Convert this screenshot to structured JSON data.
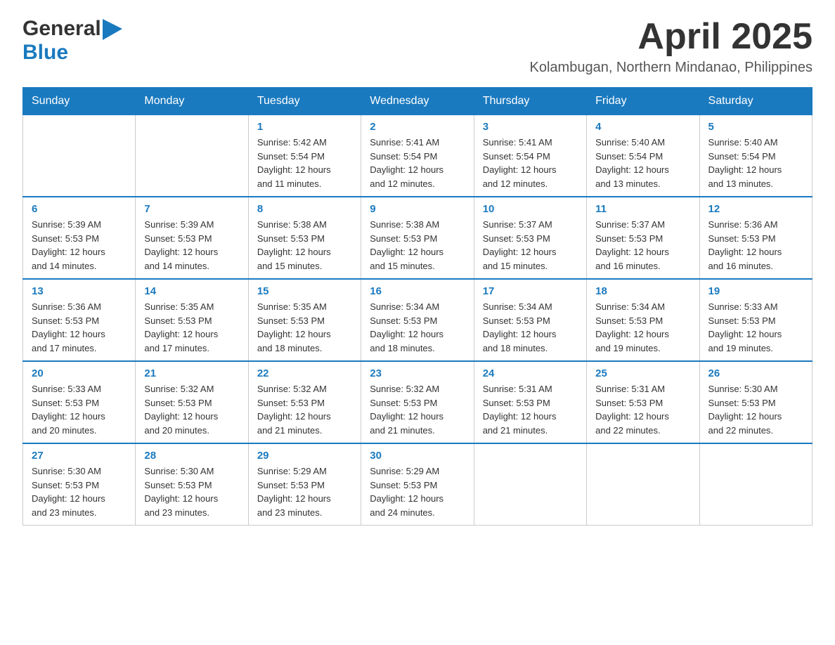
{
  "logo": {
    "general": "General",
    "blue": "Blue"
  },
  "header": {
    "month": "April 2025",
    "location": "Kolambugan, Northern Mindanao, Philippines"
  },
  "days_of_week": [
    "Sunday",
    "Monday",
    "Tuesday",
    "Wednesday",
    "Thursday",
    "Friday",
    "Saturday"
  ],
  "weeks": [
    [
      {
        "day": "",
        "info": ""
      },
      {
        "day": "",
        "info": ""
      },
      {
        "day": "1",
        "info": "Sunrise: 5:42 AM\nSunset: 5:54 PM\nDaylight: 12 hours\nand 11 minutes."
      },
      {
        "day": "2",
        "info": "Sunrise: 5:41 AM\nSunset: 5:54 PM\nDaylight: 12 hours\nand 12 minutes."
      },
      {
        "day": "3",
        "info": "Sunrise: 5:41 AM\nSunset: 5:54 PM\nDaylight: 12 hours\nand 12 minutes."
      },
      {
        "day": "4",
        "info": "Sunrise: 5:40 AM\nSunset: 5:54 PM\nDaylight: 12 hours\nand 13 minutes."
      },
      {
        "day": "5",
        "info": "Sunrise: 5:40 AM\nSunset: 5:54 PM\nDaylight: 12 hours\nand 13 minutes."
      }
    ],
    [
      {
        "day": "6",
        "info": "Sunrise: 5:39 AM\nSunset: 5:53 PM\nDaylight: 12 hours\nand 14 minutes."
      },
      {
        "day": "7",
        "info": "Sunrise: 5:39 AM\nSunset: 5:53 PM\nDaylight: 12 hours\nand 14 minutes."
      },
      {
        "day": "8",
        "info": "Sunrise: 5:38 AM\nSunset: 5:53 PM\nDaylight: 12 hours\nand 15 minutes."
      },
      {
        "day": "9",
        "info": "Sunrise: 5:38 AM\nSunset: 5:53 PM\nDaylight: 12 hours\nand 15 minutes."
      },
      {
        "day": "10",
        "info": "Sunrise: 5:37 AM\nSunset: 5:53 PM\nDaylight: 12 hours\nand 15 minutes."
      },
      {
        "day": "11",
        "info": "Sunrise: 5:37 AM\nSunset: 5:53 PM\nDaylight: 12 hours\nand 16 minutes."
      },
      {
        "day": "12",
        "info": "Sunrise: 5:36 AM\nSunset: 5:53 PM\nDaylight: 12 hours\nand 16 minutes."
      }
    ],
    [
      {
        "day": "13",
        "info": "Sunrise: 5:36 AM\nSunset: 5:53 PM\nDaylight: 12 hours\nand 17 minutes."
      },
      {
        "day": "14",
        "info": "Sunrise: 5:35 AM\nSunset: 5:53 PM\nDaylight: 12 hours\nand 17 minutes."
      },
      {
        "day": "15",
        "info": "Sunrise: 5:35 AM\nSunset: 5:53 PM\nDaylight: 12 hours\nand 18 minutes."
      },
      {
        "day": "16",
        "info": "Sunrise: 5:34 AM\nSunset: 5:53 PM\nDaylight: 12 hours\nand 18 minutes."
      },
      {
        "day": "17",
        "info": "Sunrise: 5:34 AM\nSunset: 5:53 PM\nDaylight: 12 hours\nand 18 minutes."
      },
      {
        "day": "18",
        "info": "Sunrise: 5:34 AM\nSunset: 5:53 PM\nDaylight: 12 hours\nand 19 minutes."
      },
      {
        "day": "19",
        "info": "Sunrise: 5:33 AM\nSunset: 5:53 PM\nDaylight: 12 hours\nand 19 minutes."
      }
    ],
    [
      {
        "day": "20",
        "info": "Sunrise: 5:33 AM\nSunset: 5:53 PM\nDaylight: 12 hours\nand 20 minutes."
      },
      {
        "day": "21",
        "info": "Sunrise: 5:32 AM\nSunset: 5:53 PM\nDaylight: 12 hours\nand 20 minutes."
      },
      {
        "day": "22",
        "info": "Sunrise: 5:32 AM\nSunset: 5:53 PM\nDaylight: 12 hours\nand 21 minutes."
      },
      {
        "day": "23",
        "info": "Sunrise: 5:32 AM\nSunset: 5:53 PM\nDaylight: 12 hours\nand 21 minutes."
      },
      {
        "day": "24",
        "info": "Sunrise: 5:31 AM\nSunset: 5:53 PM\nDaylight: 12 hours\nand 21 minutes."
      },
      {
        "day": "25",
        "info": "Sunrise: 5:31 AM\nSunset: 5:53 PM\nDaylight: 12 hours\nand 22 minutes."
      },
      {
        "day": "26",
        "info": "Sunrise: 5:30 AM\nSunset: 5:53 PM\nDaylight: 12 hours\nand 22 minutes."
      }
    ],
    [
      {
        "day": "27",
        "info": "Sunrise: 5:30 AM\nSunset: 5:53 PM\nDaylight: 12 hours\nand 23 minutes."
      },
      {
        "day": "28",
        "info": "Sunrise: 5:30 AM\nSunset: 5:53 PM\nDaylight: 12 hours\nand 23 minutes."
      },
      {
        "day": "29",
        "info": "Sunrise: 5:29 AM\nSunset: 5:53 PM\nDaylight: 12 hours\nand 23 minutes."
      },
      {
        "day": "30",
        "info": "Sunrise: 5:29 AM\nSunset: 5:53 PM\nDaylight: 12 hours\nand 24 minutes."
      },
      {
        "day": "",
        "info": ""
      },
      {
        "day": "",
        "info": ""
      },
      {
        "day": "",
        "info": ""
      }
    ]
  ],
  "colors": {
    "header_bg": "#1a7abf",
    "header_text": "#ffffff",
    "day_number": "#1a7abf",
    "body_text": "#333333"
  }
}
